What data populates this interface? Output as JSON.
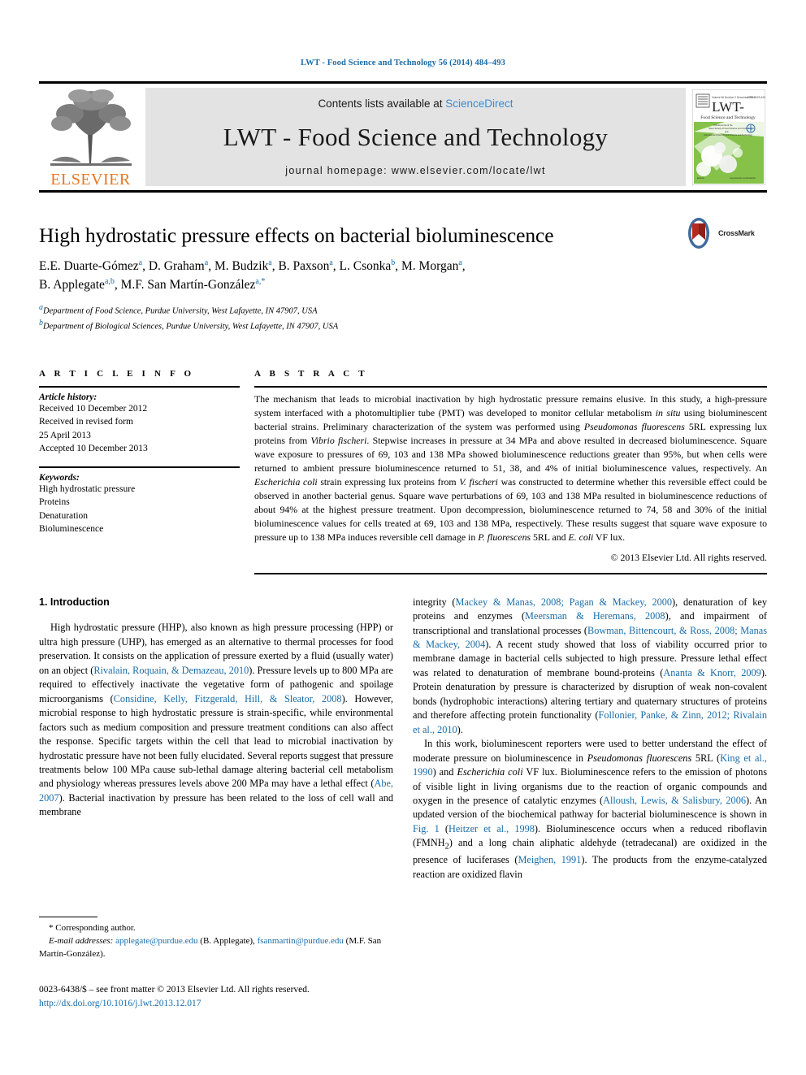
{
  "running_head": "LWT - Food Science and Technology 56 (2014) 484–493",
  "header": {
    "publisher_name": "ELSEVIER",
    "contents_prefix": "Contents lists available at ",
    "sciencedirect": "ScienceDirect",
    "journal_title": "LWT - Food Science and Technology",
    "homepage": "journal homepage: www.elsevier.com/locate/lwt",
    "cover": {
      "issue_line": "Volume 56 Issue 2 December 2014",
      "issn_line": "ISSN 0023-6438",
      "title_big": "LWT-",
      "title_sub": "Food Science and Technology",
      "sub1": "Official journal of the",
      "sub2": "Swiss Society of Food Science and Technology",
      "sub3": "and",
      "sub4": "International Union of Food Science and Technology",
      "footer_left": "Elsevier",
      "footer_right": "www.elsevier.com/locate/lwt"
    }
  },
  "article": {
    "title": "High hydrostatic pressure effects on bacterial bioluminescence",
    "authors_line1": "E.E. Duarte-Gómez a, D. Graham a, M. Budzik a, B. Paxson a, L. Csonka b, M. Morgan a,",
    "authors_line2": "B. Applegate a,b, M.F. San Martín-González a,*",
    "affiliation_a": "Department of Food Science, Purdue University, West Lafayette, IN 47907, USA",
    "affiliation_b": "Department of Biological Sciences, Purdue University, West Lafayette, IN 47907, USA",
    "crossmark_label": "CrossMark"
  },
  "article_info": {
    "heading": "A R T I C L E  I N F O",
    "history_label": "Article history:",
    "history": [
      "Received 10 December 2012",
      "Received in revised form",
      "25 April 2013",
      "Accepted 10 December 2013"
    ],
    "keywords_label": "Keywords:",
    "keywords": [
      "High hydrostatic pressure",
      "Proteins",
      "Denaturation",
      "Bioluminescence"
    ]
  },
  "abstract": {
    "heading": "A B S T R A C T",
    "text": "The mechanism that leads to microbial inactivation by high hydrostatic pressure remains elusive. In this study, a high-pressure system interfaced with a photomultiplier tube (PMT) was developed to monitor cellular metabolism in situ using bioluminescent bacterial strains. Preliminary characterization of the system was performed using Pseudomonas fluorescens 5RL expressing lux proteins from Vibrio fischeri. Stepwise increases in pressure at 34 MPa and above resulted in decreased bioluminescence. Square wave exposure to pressures of 69, 103 and 138 MPa showed bioluminescence reductions greater than 95%, but when cells were returned to ambient pressure bioluminescence returned to 51, 38, and 4% of initial bioluminescence values, respectively. An Escherichia coli strain expressing lux proteins from V. fischeri was constructed to determine whether this reversible effect could be observed in another bacterial genus. Square wave perturbations of 69, 103 and 138 MPa resulted in bioluminescence reductions of about 94% at the highest pressure treatment. Upon decompression, bioluminescence returned to 74, 58 and 30% of the initial bioluminescence values for cells treated at 69, 103 and 138 MPa, respectively. These results suggest that square wave exposure to pressure up to 138 MPa induces reversible cell damage in P. fluorescens 5RL and E. coli VF lux.",
    "copyright": "© 2013 Elsevier Ltd. All rights reserved."
  },
  "introduction": {
    "heading": "1. Introduction",
    "left_paragraph": "High hydrostatic pressure (HHP), also known as high pressure processing (HPP) or ultra high pressure (UHP), has emerged as an alternative to thermal processes for food preservation. It consists on the application of pressure exerted by a fluid (usually water) on an object (Rivalain, Roquain, & Demazeau, 2010). Pressure levels up to 800 MPa are required to effectively inactivate the vegetative form of pathogenic and spoilage microorganisms (Considine, Kelly, Fitzgerald, Hill, & Sleator, 2008). However, microbial response to high hydrostatic pressure is strain-specific, while environmental factors such as medium composition and pressure treatment conditions can also affect the response. Specific targets within the cell that lead to microbial inactivation by hydrostatic pressure have not been fully elucidated. Several reports suggest that pressure treatments below 100 MPa cause sub-lethal damage altering bacterial cell metabolism and physiology whereas pressures levels above 200 MPa may have a lethal effect (Abe, 2007). Bacterial inactivation by pressure has been related to the loss of cell wall and membrane",
    "right_paragraph_1": "integrity (Mackey & Manas, 2008; Pagan & Mackey, 2000), denaturation of key proteins and enzymes (Meersman & Heremans, 2008), and impairment of transcriptional and translational processes (Bowman, Bittencourt, & Ross, 2008; Manas & Mackey, 2004). A recent study showed that loss of viability occurred prior to membrane damage in bacterial cells subjected to high pressure. Pressure lethal effect was related to denaturation of membrane bound-proteins (Ananta & Knorr, 2009). Protein denaturation by pressure is characterized by disruption of weak non-covalent bonds (hydrophobic interactions) altering tertiary and quaternary structures of proteins and therefore affecting protein functionality (Follonier, Panke, & Zinn, 2012; Rivalain et al., 2010).",
    "right_paragraph_2": "In this work, bioluminescent reporters were used to better understand the effect of moderate pressure on bioluminescence in Pseudomonas fluorescens 5RL (King et al., 1990) and Escherichia coli VF lux. Bioluminescence refers to the emission of photons of visible light in living organisms due to the reaction of organic compounds and oxygen in the presence of catalytic enzymes (Alloush, Lewis, & Salisbury, 2006). An updated version of the biochemical pathway for bacterial bioluminescence is shown in Fig. 1 (Heitzer et al., 1998). Bioluminescence occurs when a reduced riboflavin (FMNH2) and a long chain aliphatic aldehyde (tetradecanal) are oxidized in the presence of luciferases (Meighen, 1991). The products from the enzyme-catalyzed reaction are oxidized flavin"
  },
  "footnotes": {
    "corresponding_marker": "*",
    "corresponding_text": "Corresponding author.",
    "email_label": "E-mail addresses:",
    "email_1": "applegate@purdue.edu",
    "email_1_name": "(B. Applegate),",
    "email_2": "fsanmartin@purdue.edu",
    "email_2_name": "(M.F. San Martín-González)."
  },
  "issn": {
    "line": "0023-6438/$ – see front matter © 2013 Elsevier Ltd. All rights reserved.",
    "doi": "http://dx.doi.org/10.1016/j.lwt.2013.12.017"
  },
  "colors": {
    "link": "#1a6ca8",
    "sciencedirect": "#3c8bd0",
    "elsevier_orange": "#E87722",
    "header_band": "#e3e3e3",
    "cover_green": "#7ab648",
    "crossmark_red": "#b42b20",
    "crossmark_blue": "#3f6a9b"
  }
}
